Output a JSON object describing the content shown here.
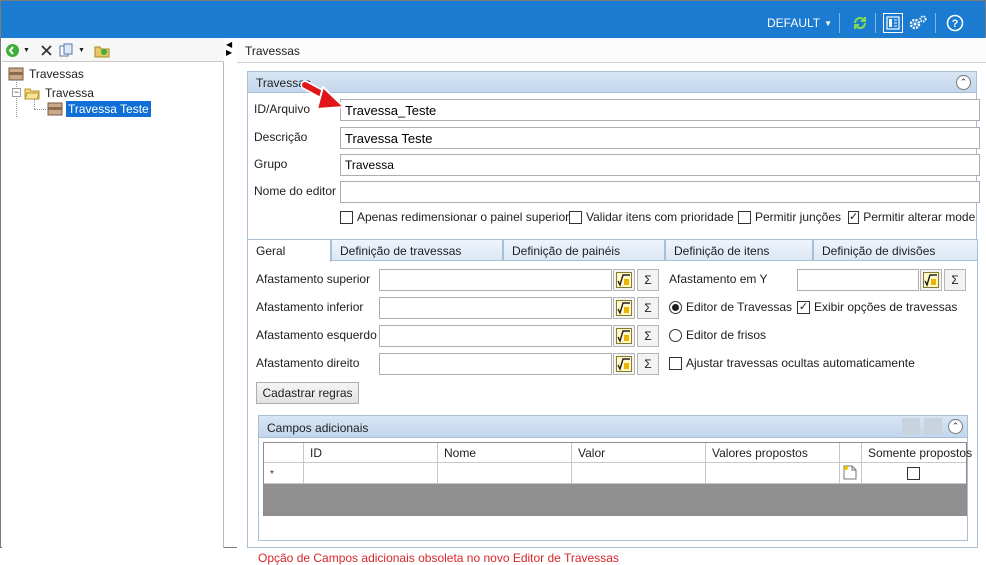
{
  "topbar": {
    "profile_label": "DEFAULT",
    "icons": [
      "refresh-icon",
      "layout-icon",
      "settings-icon",
      "help-icon"
    ]
  },
  "left_toolbar": {
    "icons": [
      "add-icon",
      "delete-icon",
      "copy-icon",
      "folder-new-icon"
    ]
  },
  "tree": {
    "root": "Travessas",
    "folder": "Travessa",
    "item": "Travessa Teste"
  },
  "right_header": {
    "title": "Travessas"
  },
  "group": {
    "title": "Travessas",
    "fields": {
      "id_label": "ID/Arquivo",
      "id_value": "Travessa_Teste",
      "desc_label": "Descrição",
      "desc_value": "Travessa Teste",
      "grupo_label": "Grupo",
      "grupo_value": "Travessa",
      "editor_label": "Nome do editor",
      "editor_value": ""
    },
    "checks": [
      {
        "label": "Apenas redimensionar o painel superior",
        "checked": false
      },
      {
        "label": "Validar itens com prioridade",
        "checked": false
      },
      {
        "label": "Permitir junções",
        "checked": false
      },
      {
        "label": "Permitir alterar modelo",
        "checked": true
      }
    ]
  },
  "tabs": [
    "Geral",
    "Definição de travessas",
    "Definição de painéis",
    "Definição de itens",
    "Definição de divisões"
  ],
  "geral": {
    "afast_superior": "Afastamento superior",
    "afast_inferior": "Afastamento inferior",
    "afast_esquerdo": "Afastamento esquerdo",
    "afast_direito": "Afastamento direito",
    "afast_y": "Afastamento em Y",
    "radio_travessas": "Editor de Travessas",
    "radio_frisos": "Editor de frisos",
    "check_exibir": "Exibir opções de travessas",
    "check_ajustar": "Ajustar travessas ocultas automaticamente",
    "sigma": "Σ",
    "cadastrar_btn": "Cadastrar regras"
  },
  "campos": {
    "title": "Campos adicionais",
    "columns": [
      "ID",
      "Nome",
      "Valor",
      "Valores propostos",
      "Somente propostos"
    ],
    "new_row_marker": "*"
  },
  "warning": "Opção de Campos adicionais obsoleta no novo Editor de Travessas",
  "colors": {
    "topbar": "#1a7bd0",
    "selection": "#0f6fd6",
    "warning": "#d9262b",
    "arrow": "#e0161b"
  }
}
